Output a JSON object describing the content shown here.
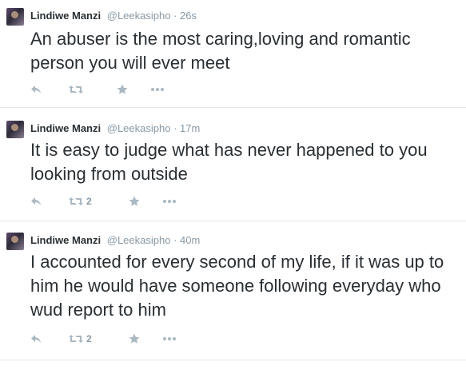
{
  "tweets": [
    {
      "name": "Lindiwe Manzi",
      "handle": "@Leekasipho",
      "separator": "·",
      "time": "26s",
      "text": "An abuser is the most caring,loving and romantic person you will ever meet",
      "retweet_count": ""
    },
    {
      "name": "Lindiwe Manzi",
      "handle": "@Leekasipho",
      "separator": "·",
      "time": "17m",
      "text": "It is easy to judge what has never happened to you looking from outside",
      "retweet_count": "2"
    },
    {
      "name": "Lindiwe Manzi",
      "handle": "@Leekasipho",
      "separator": "·",
      "time": "40m",
      "text": "I accounted for every second of my life, if it was up to him he would have someone following everyday who wud report to him",
      "retweet_count": "2"
    }
  ],
  "icons": {
    "reply": "reply-icon",
    "retweet": "retweet-icon",
    "favorite": "star-icon",
    "more": "more-icon"
  },
  "colors": {
    "text": "#292f33",
    "muted": "#8899a6",
    "icon": "#aab8c2",
    "divider": "#e1e8ed"
  }
}
